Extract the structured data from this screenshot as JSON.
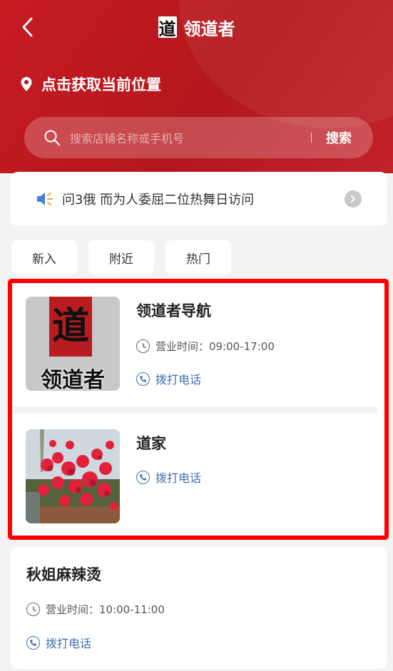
{
  "header": {
    "title": "领道者",
    "logo_char": "道",
    "location_label": "点击获取当前位置",
    "search_placeholder": "搜索店铺名称或手机号",
    "search_button": "搜索"
  },
  "notice": {
    "text": "问3俄 而为人委屈二位热舞日访问"
  },
  "tabs": [
    {
      "label": "新入"
    },
    {
      "label": "附近"
    },
    {
      "label": "热门"
    }
  ],
  "stores": [
    {
      "name": "领道者导航",
      "hours_label": "营业时间：09:00-17:00",
      "call_label": "拨打电话",
      "thumb_char": "道",
      "thumb_caption": "领道者"
    },
    {
      "name": "道家",
      "call_label": "拨打电话"
    },
    {
      "name": "秋姐麻辣烫",
      "hours_label": "营业时间：10:00-11:00",
      "call_label": "拨打电话"
    }
  ],
  "colors": {
    "brand_red": "#b3171d",
    "link_blue": "#3f6fb0",
    "highlight_red": "#ff0000"
  }
}
